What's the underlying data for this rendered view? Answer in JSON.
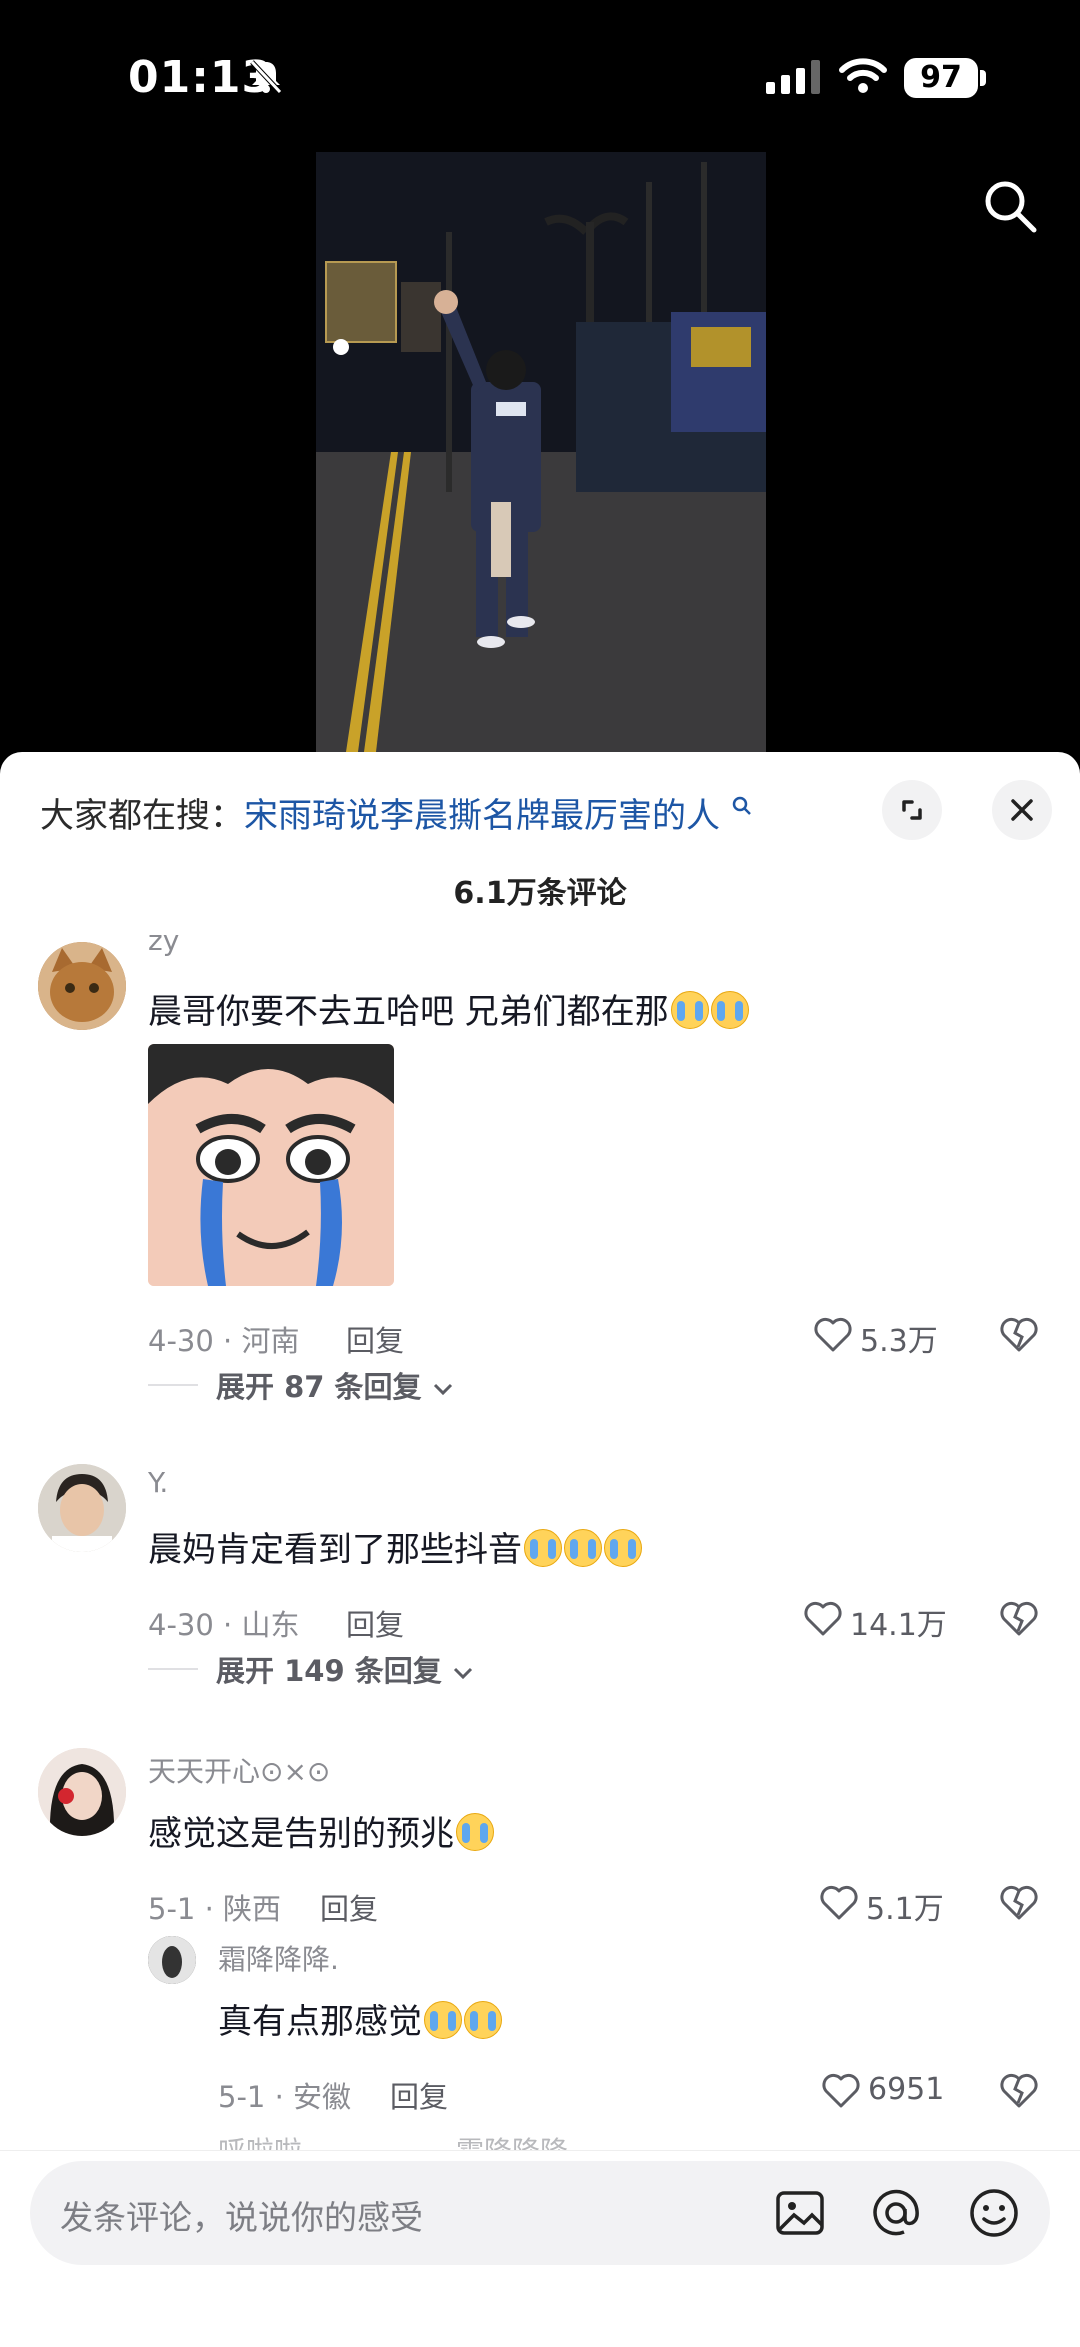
{
  "status_bar": {
    "time": "01:13",
    "battery": "97"
  },
  "sheet": {
    "search_prefix": "大家都在搜：",
    "search_term": "宋雨琦说李晨撕名牌最厉害的人",
    "comment_count": "6.1万条评论"
  },
  "comments": [
    {
      "user": "zy",
      "text": "晨哥你要不去五哈吧 兄弟们都在那",
      "date_loc": "4-30 · 河南",
      "reply": "回复",
      "likes": "5.3万",
      "expand": "展开 87 条回复"
    },
    {
      "user": "Y.",
      "text": "晨妈肯定看到了那些抖音",
      "date_loc": "4-30 · 山东",
      "reply": "回复",
      "likes": "14.1万",
      "expand": "展开 149 条回复"
    },
    {
      "user": "天天开心⊙×⊙",
      "text": "感觉这是告别的预兆",
      "date_loc": "5-1 · 陕西",
      "reply": "回复",
      "likes": "5.1万"
    },
    {
      "user": "霜降降降.",
      "text": "真有点那感觉",
      "date_loc": "5-1 · 安徽",
      "reply": "回复",
      "likes": "6951"
    }
  ],
  "partial_next": {
    "user_a": "呼啦啦",
    "user_b": "霜降降降"
  },
  "input": {
    "placeholder": "发条评论，说说你的感受"
  },
  "icons": {
    "search": "search-icon",
    "expand": "expand-icon",
    "close": "close-icon",
    "like": "heart-icon",
    "dislike": "broken-heart-icon",
    "image": "image-icon",
    "mention": "at-icon",
    "emoji": "emoji-icon"
  }
}
